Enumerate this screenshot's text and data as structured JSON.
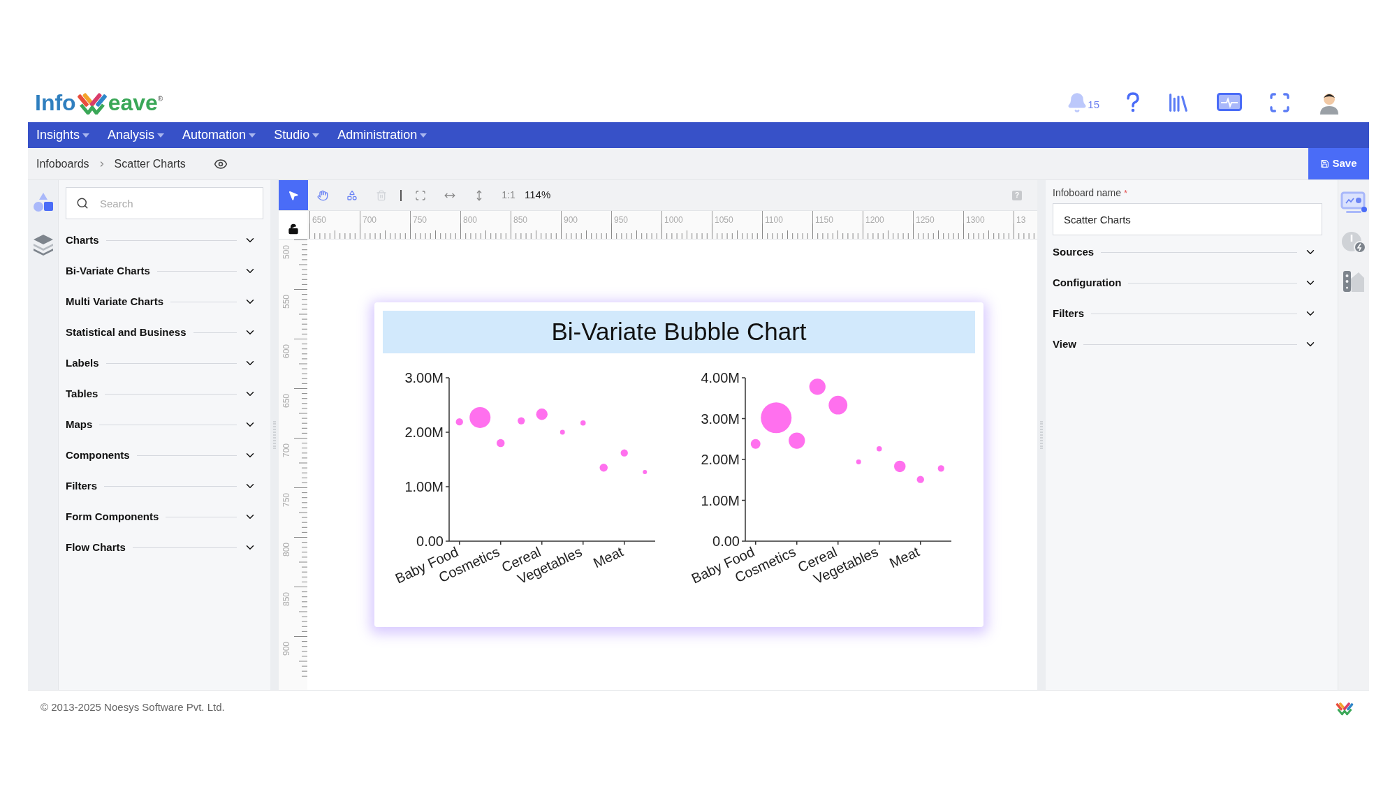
{
  "logo": {
    "left": "Info",
    "right": "eave",
    "mark": "®"
  },
  "header": {
    "notification_count": "15"
  },
  "nav": [
    {
      "label": "Insights"
    },
    {
      "label": "Analysis"
    },
    {
      "label": "Automation"
    },
    {
      "label": "Studio"
    },
    {
      "label": "Administration"
    }
  ],
  "breadcrumb": [
    "Infoboards",
    "Scatter Charts"
  ],
  "save_button": "Save",
  "left_panel": {
    "search": {
      "placeholder": "Search"
    },
    "sections": [
      {
        "label": "Charts",
        "expanded": false
      },
      {
        "label": "Bi-Variate Charts",
        "expanded": false
      },
      {
        "label": "Multi Variate Charts",
        "expanded": false
      },
      {
        "label": "Statistical and Business",
        "expanded": false
      },
      {
        "label": "Labels",
        "expanded": false
      },
      {
        "label": "Tables",
        "expanded": false
      },
      {
        "label": "Maps",
        "expanded": false
      },
      {
        "label": "Components",
        "expanded": false
      },
      {
        "label": "Filters",
        "expanded": false
      },
      {
        "label": "Form Components",
        "expanded": false
      },
      {
        "label": "Flow Charts",
        "expanded": false
      }
    ]
  },
  "toolbar": {
    "tools": [
      {
        "kind": "pointer",
        "selected": true,
        "disabled": false
      },
      {
        "kind": "hand",
        "selected": false,
        "disabled": false
      },
      {
        "kind": "shapes",
        "selected": false,
        "disabled": false
      },
      {
        "kind": "trash",
        "selected": false,
        "disabled": true
      }
    ],
    "view_tools": [
      {
        "kind": "fit"
      },
      {
        "kind": "width"
      },
      {
        "kind": "height"
      }
    ],
    "actual_size": "1:1",
    "zoom": "114%",
    "help": "?"
  },
  "rulers": {
    "horizontal": [
      "650",
      "700",
      "750",
      "800",
      "850",
      "900",
      "950",
      "1000",
      "1050",
      "1100",
      "1150",
      "1200",
      "1250",
      "1300",
      "13"
    ],
    "vertical": [
      "500",
      "550",
      "600",
      "650",
      "700",
      "750",
      "800",
      "850",
      "900"
    ]
  },
  "board": {
    "title": "Bi-Variate Bubble Chart",
    "charts": [
      {
        "chart_data": {
          "type": "scatter",
          "categories": [
            "Baby Food",
            null,
            "Cosmetics",
            null,
            "Cereal",
            null,
            "Vegetables",
            null,
            "Meat",
            null
          ],
          "ylim": [
            0,
            3000000
          ],
          "yticks": [
            {
              "value": 0,
              "label": "0.00"
            },
            {
              "value": 1000000,
              "label": "1.00M"
            },
            {
              "value": 2000000,
              "label": "2.00M"
            },
            {
              "value": 3000000,
              "label": "3.00M"
            }
          ],
          "series": [
            {
              "color": "#ff70ee",
              "values": [
                2190000,
                2270000,
                1800000,
                2210000,
                2330000,
                2000000,
                2170000,
                1350000,
                1620000,
                1270000
              ],
              "sizes": [
                0.119,
                1,
                0.147,
                0.119,
                0.298,
                0.053,
                0.064,
                0.147,
                0.119,
                0.04
              ]
            }
          ]
        }
      },
      {
        "chart_data": {
          "type": "scatter",
          "categories": [
            "Baby Food",
            null,
            "Cosmetics",
            null,
            "Cereal",
            null,
            "Vegetables",
            null,
            "Meat",
            null
          ],
          "ylim": [
            0,
            4000000
          ],
          "yticks": [
            {
              "value": 0,
              "label": "0.00"
            },
            {
              "value": 1000000,
              "label": "1.00M"
            },
            {
              "value": 2000000,
              "label": "2.00M"
            },
            {
              "value": 3000000,
              "label": "3.00M"
            },
            {
              "value": 4000000,
              "label": "4.00M"
            }
          ],
          "series": [
            {
              "color": "#ff70ee",
              "values": [
                2380000,
                3020000,
                2460000,
                3780000,
                3330000,
                1940000,
                2260000,
                1830000,
                1510000,
                1780000
              ],
              "sizes": [
                0.1,
                1,
                0.28,
                0.28,
                0.37,
                0.025,
                0.03,
                0.14,
                0.056,
                0.044
              ]
            }
          ]
        }
      }
    ]
  },
  "right_panel": {
    "name_field": {
      "label": "Infoboard name",
      "required_mark": "*",
      "value": "Scatter Charts"
    },
    "sections": [
      {
        "label": "Sources",
        "expanded": false
      },
      {
        "label": "Configuration",
        "expanded": false
      },
      {
        "label": "Filters",
        "expanded": false
      },
      {
        "label": "View",
        "expanded": false
      }
    ]
  },
  "footer": {
    "copyright": "© 2013-2025 Noesys Software Pvt. Ltd."
  }
}
